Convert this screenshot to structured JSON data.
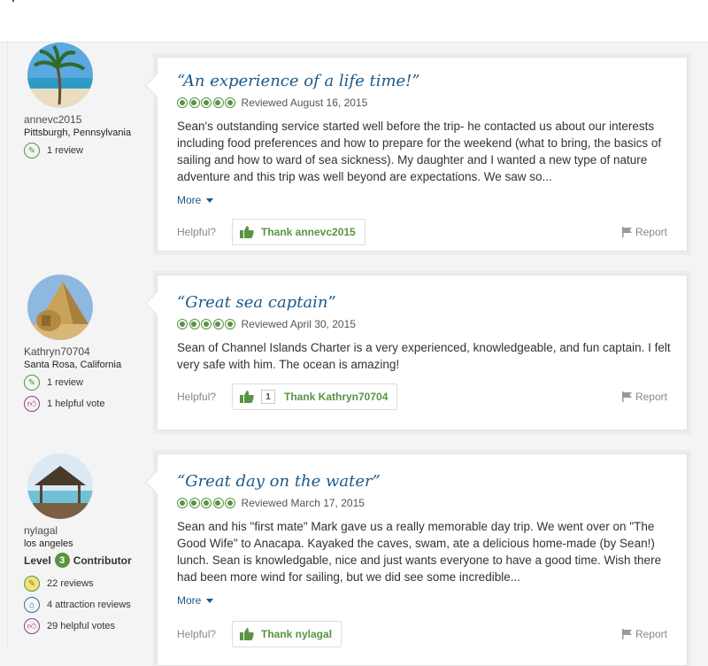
{
  "reviews": [
    {
      "username": "annevc2015",
      "location": "Pittsburgh, Pennsylvania",
      "stats": [
        "1 review"
      ],
      "title": "“An experience of a life time!”",
      "rating": 5,
      "reviewed": "Reviewed August 16, 2015",
      "body": "Sean's outstanding service started well before the trip- he contacted us about our interests including food preferences and how to prepare for the weekend (what to bring, the basics of sailing and how to ward of sea sickness). My daughter and I wanted a new type of nature adventure and this trip was well beyond are expectations. We saw so...",
      "more": "More",
      "helpful": "Helpful?",
      "thank": "Thank annevc2015",
      "report": "Report"
    },
    {
      "username": "Kathryn70704",
      "location": "Santa Rosa, California",
      "stats": [
        "1 review",
        "1 helpful vote"
      ],
      "title": "“Great sea captain”",
      "rating": 5,
      "reviewed": "Reviewed April 30, 2015",
      "body": "Sean of Channel Islands Charter is a very experienced, knowledgeable, and fun captain. I felt very safe with him. The ocean is amazing!",
      "helpful": "Helpful?",
      "thank_count": "1",
      "thank": "Thank Kathryn70704",
      "report": "Report"
    },
    {
      "username": "nylagal",
      "location": "los angeles",
      "level_prefix": "Level",
      "level": "3",
      "level_suffix": "Contributor",
      "stats": [
        "22 reviews",
        "4 attraction reviews",
        "29 helpful votes"
      ],
      "title": "“Great day on the water”",
      "rating": 5,
      "reviewed": "Reviewed March 17, 2015",
      "body": "Sean and his \"first mate\" Mark gave us a really memorable day trip. We went over on \"The Good Wife\" to Anacapa. Kayaked the caves, swam, ate a delicious home-made (by Sean!) lunch. Sean is knowledgable, nice and just wants everyone to have a good time. Wish there had been more wind for sailing, but we did see some incredible...",
      "more": "More",
      "helpful": "Helpful?",
      "thank": "Thank nylagal",
      "report": "Report"
    }
  ],
  "colors": {
    "accent_green": "#589442",
    "link_blue": "#1a5a8c"
  }
}
